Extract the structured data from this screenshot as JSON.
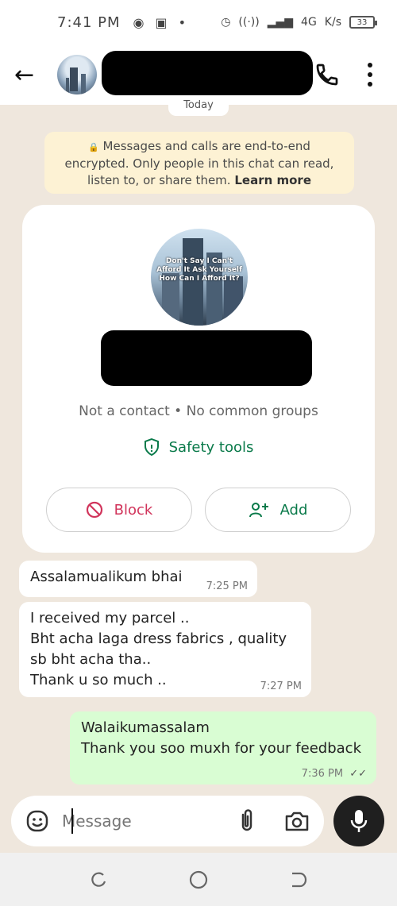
{
  "status_bar": {
    "time": "7:41 PM",
    "network": "4G",
    "speed_unit": "K/s",
    "battery": "33"
  },
  "header": {
    "back_icon": "arrow-left-icon",
    "call_icon": "phone-icon",
    "menu_icon": "more-vertical-icon"
  },
  "date_chip": "Today",
  "encryption_notice": {
    "text": "Messages and calls are end-to-end encrypted. Only people in this chat can read, listen to, or share them.",
    "link": "Learn more"
  },
  "contact_card": {
    "avatar_quote": "Don't Say I Can't Afford It Ask Yourself How Can I Afford It?",
    "subtitle": "Not a contact • No common groups",
    "safety_tools": "Safety tools",
    "block_label": "Block",
    "add_label": "Add"
  },
  "messages": [
    {
      "direction": "in",
      "text": "Assalamualikum bhai",
      "time": "7:25 PM"
    },
    {
      "direction": "in",
      "text": "I received my parcel ..\nBht acha laga dress fabrics , quality sb bht acha tha..\nThank u so much ..",
      "time": "7:27 PM"
    },
    {
      "direction": "out",
      "text": "Walaikumassalam\nThank you soo muxh for your feedback",
      "time": "7:36 PM",
      "status": "read"
    }
  ],
  "composer": {
    "placeholder": "Message"
  },
  "colors": {
    "accent_green": "#0a7a4a",
    "block_red": "#d1345b",
    "outgoing_bubble": "#d9fdd3",
    "chat_background": "#efe7dd",
    "encryption_bg": "#fdf2d4"
  }
}
